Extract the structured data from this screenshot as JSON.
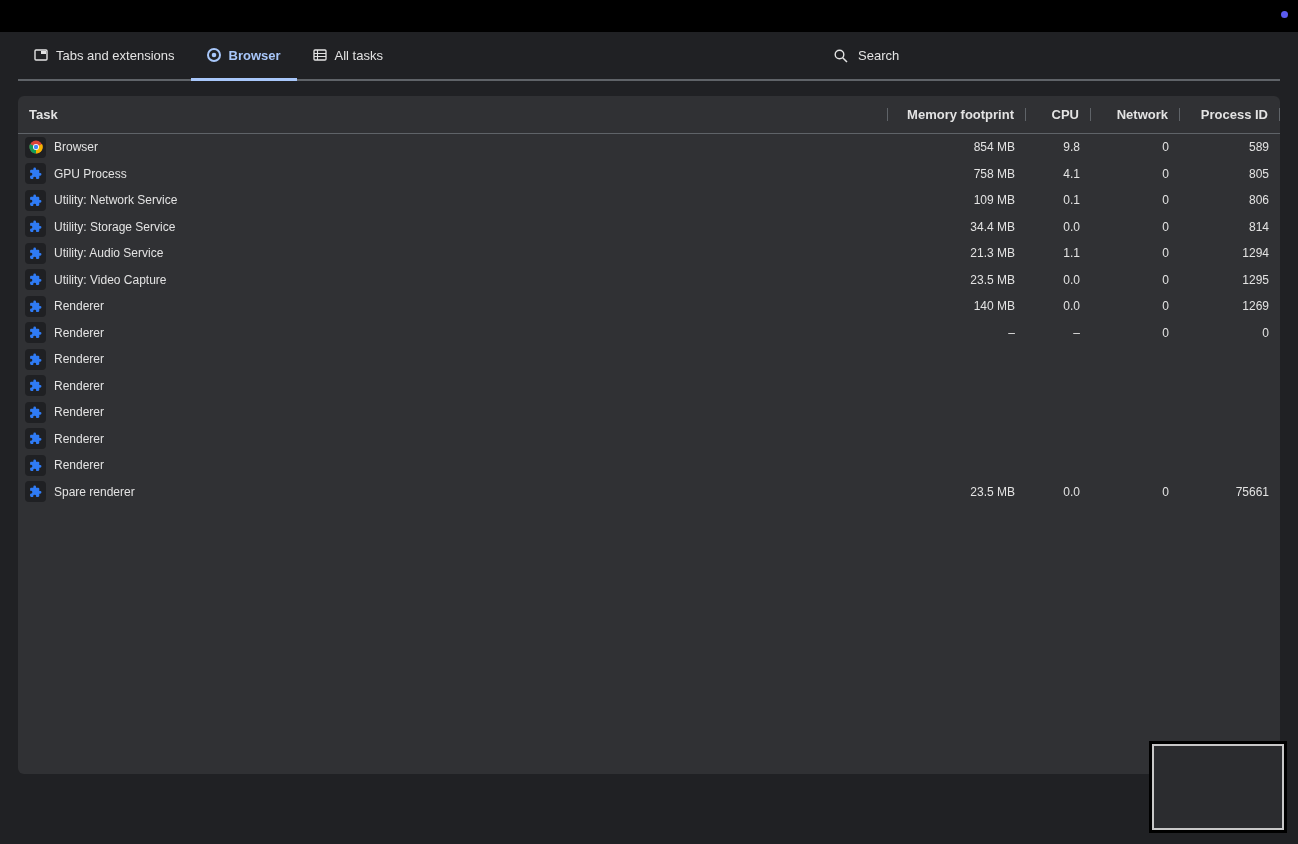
{
  "tabs": [
    {
      "label": "Tabs and extensions",
      "kind": "window",
      "selected": false
    },
    {
      "label": "Browser",
      "kind": "browser",
      "selected": true
    },
    {
      "label": "All tasks",
      "kind": "list",
      "selected": false
    }
  ],
  "search": {
    "placeholder": "Search"
  },
  "table": {
    "columns": [
      "Task",
      "Memory footprint",
      "CPU",
      "Network",
      "Process ID"
    ],
    "rows": [
      {
        "kind": "browser",
        "task": "Browser",
        "memory": "854 MB",
        "cpu": "9.8",
        "network": "0",
        "pid": "589"
      },
      {
        "kind": "extension",
        "task": "GPU Process",
        "memory": "758 MB",
        "cpu": "4.1",
        "network": "0",
        "pid": "805"
      },
      {
        "kind": "extension",
        "task": "Utility: Network Service",
        "memory": "109 MB",
        "cpu": "0.1",
        "network": "0",
        "pid": "806"
      },
      {
        "kind": "extension",
        "task": "Utility: Storage Service",
        "memory": "34.4 MB",
        "cpu": "0.0",
        "network": "0",
        "pid": "814"
      },
      {
        "kind": "extension",
        "task": "Utility: Audio Service",
        "memory": "21.3 MB",
        "cpu": "1.1",
        "network": "0",
        "pid": "1294"
      },
      {
        "kind": "extension",
        "task": "Utility: Video Capture",
        "memory": "23.5 MB",
        "cpu": "0.0",
        "network": "0",
        "pid": "1295"
      },
      {
        "kind": "extension",
        "task": "Renderer",
        "memory": "140 MB",
        "cpu": "0.0",
        "network": "0",
        "pid": "1269"
      },
      {
        "kind": "extension",
        "task": "Renderer",
        "memory": "–",
        "cpu": "–",
        "network": "0",
        "pid": "0"
      },
      {
        "kind": "extension",
        "task": "Renderer"
      },
      {
        "kind": "extension",
        "task": "Renderer"
      },
      {
        "kind": "extension",
        "task": "Renderer"
      },
      {
        "kind": "extension",
        "task": "Renderer"
      },
      {
        "kind": "extension",
        "task": "Renderer"
      },
      {
        "kind": "extension",
        "task": "Spare renderer",
        "memory": "23.5 MB",
        "cpu": "0.0",
        "network": "0",
        "pid": "75661"
      }
    ]
  }
}
